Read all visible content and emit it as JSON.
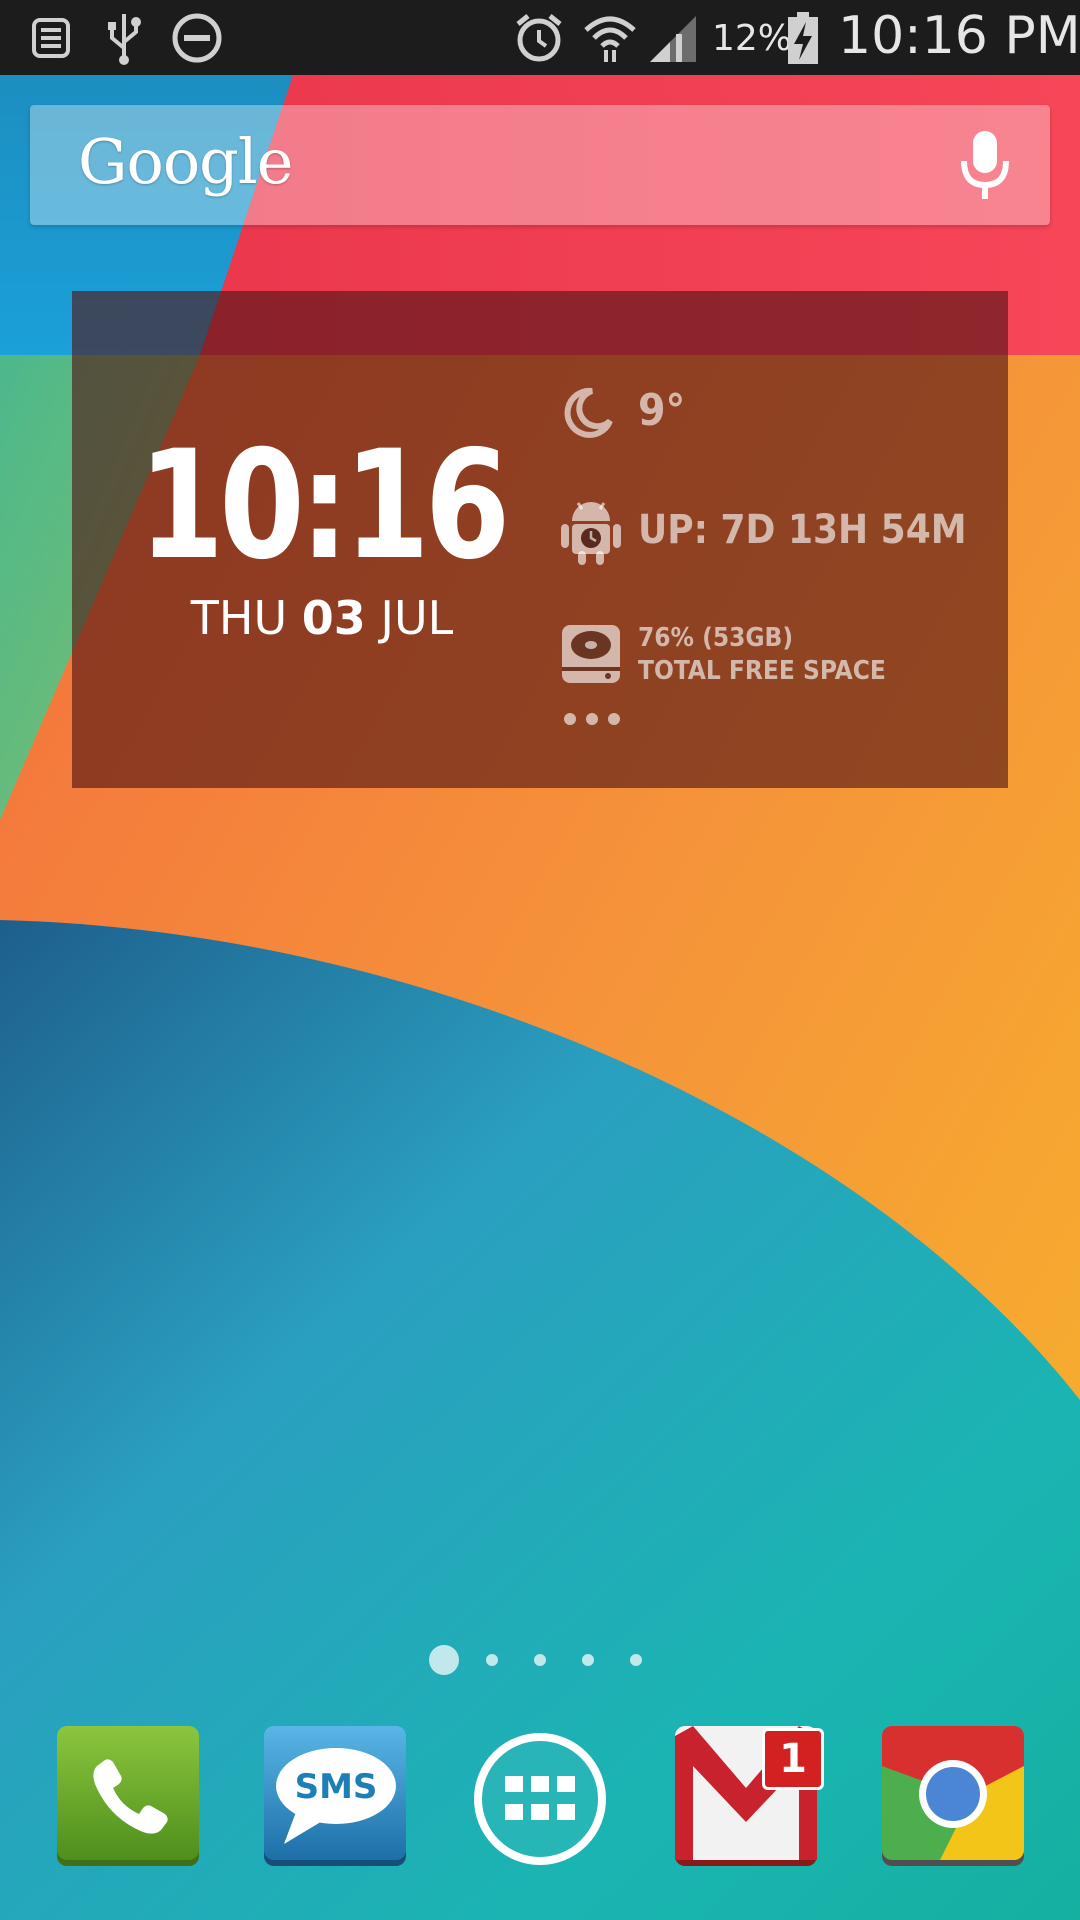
{
  "status_bar": {
    "battery_percent": "12%",
    "time": "10:16 PM",
    "icons": [
      "notification-list-icon",
      "usb-icon",
      "do-not-disturb-icon",
      "alarm-icon",
      "wifi-icon",
      "signal-icon",
      "battery-charging-icon"
    ]
  },
  "search_widget": {
    "logo_text": "Google",
    "mic_icon": "microphone-icon"
  },
  "clock_widget": {
    "time": "10:16",
    "date_weekday": "THU",
    "date_day": "03",
    "date_month": "JUL",
    "weather_temp": "9°",
    "weather_icon": "moon-icon",
    "uptime": "UP: 7D 13H 54M",
    "uptime_icon": "android-clock-icon",
    "storage_line1": "76% (53GB)",
    "storage_line2": "TOTAL FREE SPACE",
    "storage_icon": "hard-drive-icon",
    "more_icon": "more-dots-icon"
  },
  "page_indicator": {
    "pages": 5,
    "current": 1
  },
  "dock": {
    "apps": [
      "Phone",
      "SMS",
      "App Drawer",
      "Gmail",
      "Chrome"
    ],
    "sms_label": "SMS",
    "gmail_badge": "1"
  },
  "colors": {
    "status_bar": "#1c1c1c",
    "widget_bg": "#501414",
    "wallpaper_red": "#f03c50",
    "wallpaper_orange": "#f5873a",
    "wallpaper_teal": "#1aa6b0"
  }
}
